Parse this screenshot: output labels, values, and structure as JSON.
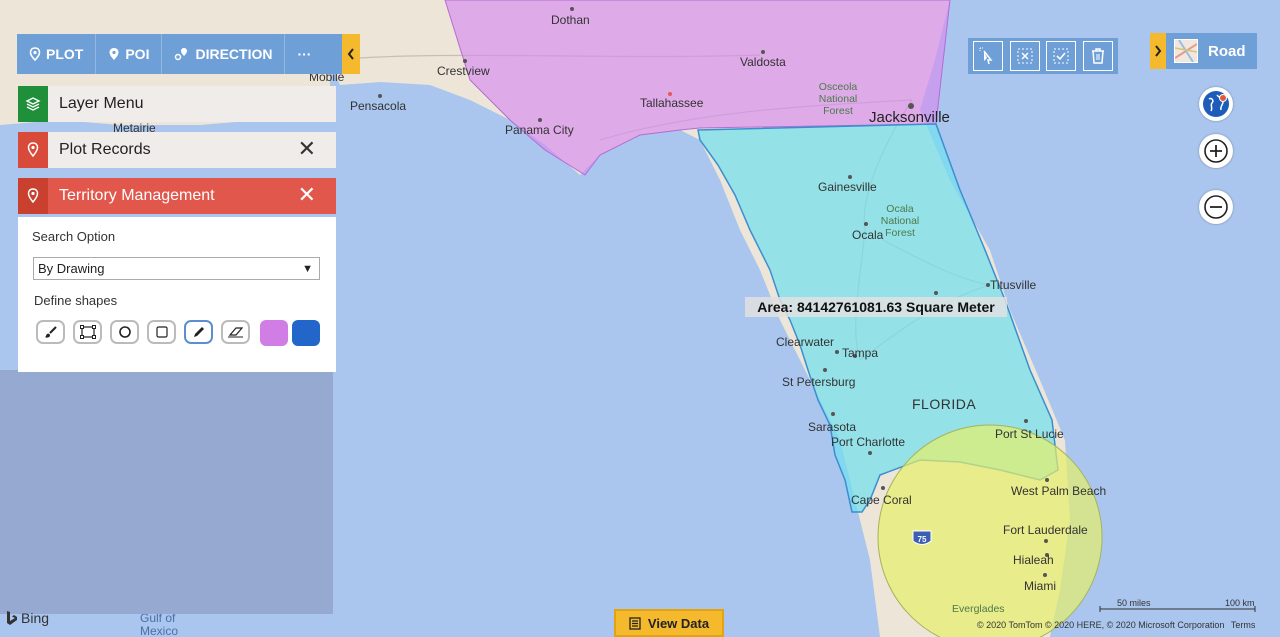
{
  "nav": {
    "plot": "PLOT",
    "poi": "POI",
    "direction": "DIRECTION",
    "more": "···"
  },
  "layers": {
    "layer_menu": "Layer Menu",
    "plot_records": "Plot Records",
    "territory_management": "Territory Management"
  },
  "territory": {
    "search_option_label": "Search Option",
    "search_option_value": "By Drawing",
    "define_shapes_label": "Define shapes",
    "swatch_colors": [
      "#d07ee6",
      "#2166c8"
    ]
  },
  "map": {
    "road_label": "Road",
    "area_text": "Area: 84142761081.63 Square Meter",
    "view_data": "View Data",
    "bing": "Bing",
    "scale_miles": "50 miles",
    "scale_km": "100 km",
    "copyright": "© 2020 TomTom © 2020 HERE, © 2020 Microsoft Corporation",
    "terms": "Terms",
    "labels": {
      "dothan": "Dothan",
      "valdosta": "Valdosta",
      "crestview": "Crestview",
      "mobile": "Mobile",
      "pensacola": "Pensacola",
      "metairie": "Metairie",
      "tallahassee": "Tallahassee",
      "panama_city": "Panama City",
      "osceola": [
        "Osceola",
        "National",
        "Forest"
      ],
      "jacksonville": "Jacksonville",
      "gainesville": "Gainesville",
      "ocala_forest": [
        "Ocala",
        "National",
        "Forest"
      ],
      "ocala": "Ocala",
      "titusville": "Titusville",
      "clearwater": "Clearwater",
      "tampa": "Tampa",
      "st_petersburg": "St Petersburg",
      "florida": "FLORIDA",
      "sarasota": "Sarasota",
      "port_charlotte": "Port Charlotte",
      "port_st_lucie": "Port St Lucie",
      "cape_coral": "Cape Coral",
      "west_palm_beach": "West Palm Beach",
      "fort_lauderdale": "Fort Lauderdale",
      "hialeah": "Hialeah",
      "miami": "Miami",
      "everglades": "Everglades",
      "gulf_of_mexico": [
        "Gulf of",
        "Mexico"
      ],
      "i75": "75"
    }
  }
}
